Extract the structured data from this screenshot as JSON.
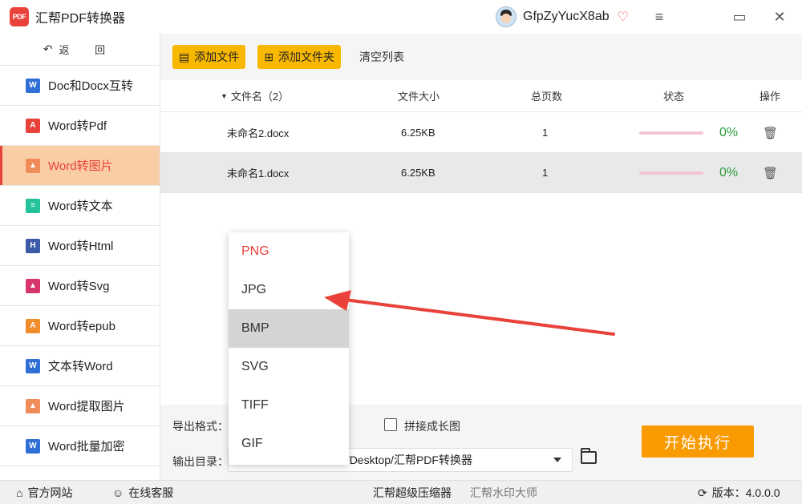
{
  "app": {
    "logo_text": "PDF",
    "title": "汇帮PDF转换器"
  },
  "user": {
    "name": "GfpZyYucX8ab"
  },
  "window_controls": {
    "menu": "≡",
    "maximize": "▭",
    "close": "✕"
  },
  "sidebar": {
    "back_label": "返 回",
    "items": [
      {
        "label": "Doc和Docx互转",
        "icon": "word-icon",
        "color": "#2f6fd6",
        "glyph": "W"
      },
      {
        "label": "Word转Pdf",
        "icon": "pdf-icon",
        "color": "#e8423b",
        "glyph": "A"
      },
      {
        "label": "Word转图片",
        "icon": "image-icon",
        "color": "#f08c5a",
        "glyph": "▲",
        "active": true
      },
      {
        "label": "Word转文本",
        "icon": "text-icon",
        "color": "#23c29a",
        "glyph": "≡"
      },
      {
        "label": "Word转Html",
        "icon": "html-icon",
        "color": "#3a5ba8",
        "glyph": "H"
      },
      {
        "label": "Word转Svg",
        "icon": "svg-icon",
        "color": "#d8366a",
        "glyph": "▲"
      },
      {
        "label": "Word转epub",
        "icon": "epub-icon",
        "color": "#f08c2a",
        "glyph": "A"
      },
      {
        "label": "文本转Word",
        "icon": "word-icon",
        "color": "#2f6fd6",
        "glyph": "W"
      },
      {
        "label": "Word提取图片",
        "icon": "image-icon",
        "color": "#f08c5a",
        "glyph": "▲"
      },
      {
        "label": "Word批量加密",
        "icon": "word-icon",
        "color": "#2f6fd6",
        "glyph": "W"
      }
    ]
  },
  "toolbar": {
    "add_file": "添加文件",
    "add_folder": "添加文件夹",
    "clear_list": "清空列表"
  },
  "table": {
    "headers": {
      "name": "文件名（2）",
      "size": "文件大小",
      "pages": "总页数",
      "status": "状态",
      "action": "操作"
    },
    "rows": [
      {
        "name": "未命名2.docx",
        "size": "6.25KB",
        "pages": "1",
        "progress": "0%"
      },
      {
        "name": "未命名1.docx",
        "size": "6.25KB",
        "pages": "1",
        "progress": "0%"
      }
    ]
  },
  "bottom": {
    "export_format_label": "导出格式：",
    "stitch_label": "拼接成长图",
    "output_dir_label": "输出目录：",
    "output_dir_value": "C:/Users/Administrator/Desktop/汇帮PDF转换器",
    "start_button": "开始执行"
  },
  "format_dropdown": {
    "options": [
      "PNG",
      "JPG",
      "BMP",
      "SVG",
      "TIFF",
      "GIF"
    ],
    "selected": "PNG",
    "hovered": "BMP"
  },
  "statusbar": {
    "official_site": "官方网站",
    "online_support": "在线客服",
    "compressor": "汇帮超级压缩器",
    "watermark": "汇帮水印大师",
    "version": "版本：4.0.0.0"
  },
  "colors": {
    "accent": "#f9b800",
    "start": "#f99a00",
    "active_bg": "#f9cda5",
    "active_text": "#e8423b",
    "progress_text": "#2a9b3a",
    "arrow": "#e8423b"
  }
}
